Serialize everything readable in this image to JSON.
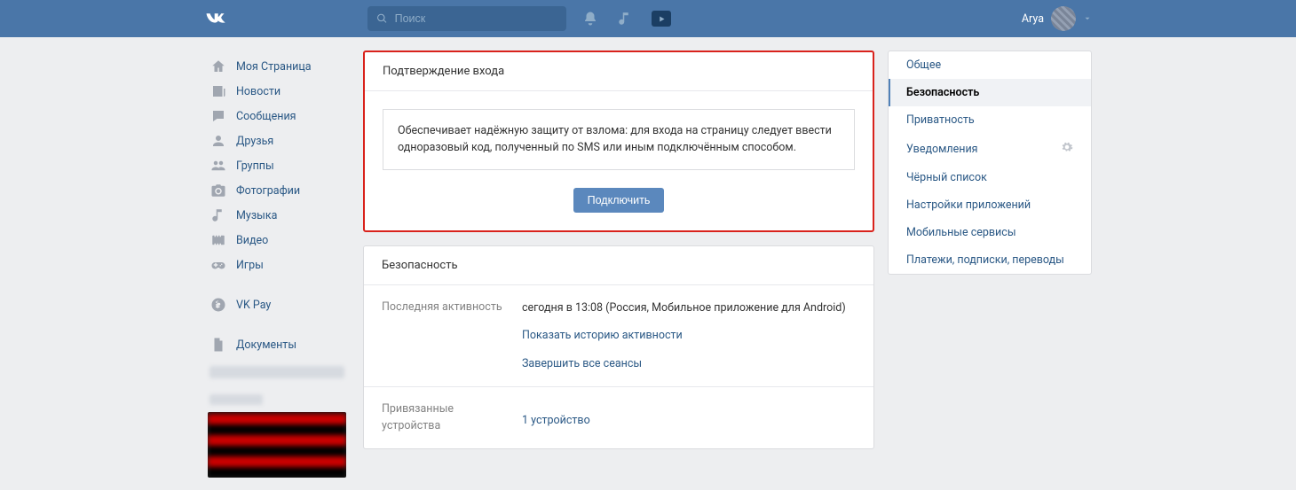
{
  "header": {
    "search_placeholder": "Поиск",
    "user_name": "Arya"
  },
  "sidebar": {
    "items": [
      {
        "label": "Моя Страница",
        "icon": "home"
      },
      {
        "label": "Новости",
        "icon": "news"
      },
      {
        "label": "Сообщения",
        "icon": "messages"
      },
      {
        "label": "Друзья",
        "icon": "friends"
      },
      {
        "label": "Группы",
        "icon": "groups"
      },
      {
        "label": "Фотографии",
        "icon": "photos"
      },
      {
        "label": "Музыка",
        "icon": "music"
      },
      {
        "label": "Видео",
        "icon": "video"
      },
      {
        "label": "Игры",
        "icon": "games"
      }
    ],
    "items2": [
      {
        "label": "VK Pay",
        "icon": "pay"
      }
    ],
    "items3": [
      {
        "label": "Документы",
        "icon": "docs"
      }
    ]
  },
  "confirm": {
    "title": "Подтверждение входа",
    "desc": "Обеспечивает надёжную защиту от взлома: для входа на страницу следует ввести одноразовый код, полученный по SMS или иным подключённым способом.",
    "button": "Подключить"
  },
  "security": {
    "title": "Безопасность",
    "last_activity_label": "Последняя активность",
    "last_activity_value": "сегодня в 13:08 (Россия, Мобильное приложение для Android)",
    "show_history": "Показать историю активности",
    "end_sessions": "Завершить все сеансы",
    "devices_label": "Привязанные устройства",
    "devices_value": "1 устройство"
  },
  "aside": {
    "items": [
      "Общее",
      "Безопасность",
      "Приватность",
      "Уведомления",
      "Чёрный список",
      "Настройки приложений",
      "Мобильные сервисы",
      "Платежи, подписки, переводы"
    ],
    "active_index": 1,
    "gear_index": 3
  }
}
